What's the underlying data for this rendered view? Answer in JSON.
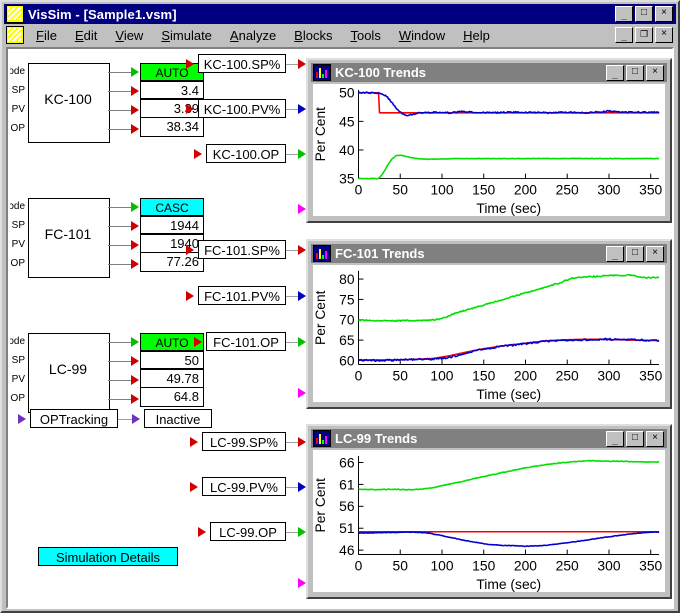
{
  "window": {
    "title": "VisSim - [Sample1.vsm]",
    "app_icon": "vissim-icon",
    "minimize_label": "_",
    "maximize_label": "□",
    "close_label": "×",
    "mdi_restore_label": "❐"
  },
  "menu": {
    "items": [
      {
        "label": "File",
        "accel": "F"
      },
      {
        "label": "Edit",
        "accel": "E"
      },
      {
        "label": "View",
        "accel": "V"
      },
      {
        "label": "Simulate",
        "accel": "S"
      },
      {
        "label": "Analyze",
        "accel": "A"
      },
      {
        "label": "Blocks",
        "accel": "B"
      },
      {
        "label": "Tools",
        "accel": "T"
      },
      {
        "label": "Window",
        "accel": "W"
      },
      {
        "label": "Help",
        "accel": "H"
      }
    ]
  },
  "controllers": [
    {
      "name": "KC-100",
      "pins": [
        "Mode",
        "SP",
        "PV",
        "OP"
      ],
      "mode": "AUTO",
      "mode_color": "#00ff00",
      "sp": "3.4",
      "pv": "3.39",
      "op": "38.34"
    },
    {
      "name": "FC-101",
      "pins": [
        "Mode",
        "SP",
        "PV",
        "OP"
      ],
      "mode": "CASC",
      "mode_color": "#00ffff",
      "sp": "1944",
      "pv": "1940",
      "op": "77.26"
    },
    {
      "name": "LC-99",
      "pins": [
        "Mode",
        "SP",
        "PV",
        "OP"
      ],
      "mode": "AUTO",
      "mode_color": "#00ff00",
      "sp": "50",
      "pv": "49.78",
      "op": "64.8"
    }
  ],
  "signals": [
    {
      "label": "KC-100.SP%",
      "out_color": "red"
    },
    {
      "label": "KC-100.PV%",
      "out_color": "blue"
    },
    {
      "label": "KC-100.OP",
      "out_color": "green"
    },
    {
      "label": "FC-101.SP%",
      "out_color": "red"
    },
    {
      "label": "FC-101.PV%",
      "out_color": "blue"
    },
    {
      "label": "FC-101.OP",
      "out_color": "green"
    },
    {
      "label": "LC-99.SP%",
      "out_color": "red"
    },
    {
      "label": "LC-99.PV%",
      "out_color": "blue"
    },
    {
      "label": "LC-99.OP",
      "out_color": "green"
    }
  ],
  "op_tracking": {
    "label": "OPTracking",
    "status": "Inactive"
  },
  "simulation_details": {
    "label": "Simulation Details",
    "color": "#00ffff"
  },
  "chart_data": [
    {
      "type": "line",
      "title": "KC-100 Trends",
      "xlabel": "Time (sec)",
      "ylabel": "Per Cent",
      "xlim": [
        0,
        360
      ],
      "ylim": [
        35,
        50.5
      ],
      "xticks": [
        0,
        50,
        100,
        150,
        200,
        250,
        300,
        350
      ],
      "yticks": [
        35,
        40,
        45,
        50
      ],
      "grid": false,
      "legend": "none",
      "series": [
        {
          "name": "SP",
          "color": "#ff0000",
          "x": [
            0,
            25,
            25,
            360
          ],
          "values": [
            50,
            50,
            46.5,
            46.5
          ]
        },
        {
          "name": "PV",
          "color": "#0000cd",
          "x": [
            0,
            10,
            20,
            28,
            34,
            40,
            46,
            52,
            58,
            64,
            70,
            80,
            95,
            110,
            125,
            140,
            160,
            180,
            200,
            225,
            250,
            275,
            300,
            320,
            340,
            360
          ],
          "values": [
            50,
            50,
            50,
            49.9,
            49.3,
            48.3,
            47.2,
            46.4,
            46.1,
            46.2,
            46.4,
            46.5,
            46.6,
            46.5,
            46.7,
            46.6,
            46.5,
            46.6,
            46.6,
            46.5,
            46.6,
            46.5,
            46.8,
            46.6,
            46.6,
            46.6
          ],
          "noise": 0.12
        },
        {
          "name": "OP",
          "color": "#00e000",
          "x": [
            0,
            24,
            28,
            32,
            36,
            40,
            45,
            50,
            56,
            62,
            70,
            80,
            95,
            115,
            140,
            170,
            200,
            240,
            280,
            320,
            360
          ],
          "values": [
            35,
            35,
            35.6,
            36.6,
            37.6,
            38.4,
            39.0,
            39.1,
            38.9,
            38.7,
            38.5,
            38.4,
            38.4,
            38.5,
            38.5,
            38.5,
            38.5,
            38.5,
            38.5,
            38.5,
            38.5
          ],
          "noise": 0.04
        }
      ]
    },
    {
      "type": "line",
      "title": "FC-101 Trends",
      "xlabel": "Time (sec)",
      "ylabel": "Per Cent",
      "xlim": [
        0,
        360
      ],
      "ylim": [
        59,
        82
      ],
      "xticks": [
        0,
        50,
        100,
        150,
        200,
        250,
        300,
        350
      ],
      "yticks": [
        60,
        65,
        70,
        75,
        80
      ],
      "grid": false,
      "legend": "none",
      "series": [
        {
          "name": "SP",
          "color": "#ff0000",
          "x": [
            0,
            60,
            90,
            110,
            130,
            150,
            170,
            190,
            210,
            230,
            250,
            270,
            290,
            310,
            330,
            360
          ],
          "values": [
            60.1,
            60.2,
            60.5,
            61.2,
            62.1,
            62.9,
            63.5,
            64.0,
            64.5,
            64.9,
            65.1,
            65.2,
            65.2,
            65.1,
            65.0,
            64.9
          ]
        },
        {
          "name": "PV",
          "color": "#0000cd",
          "x": [
            0,
            20,
            40,
            60,
            80,
            100,
            115,
            130,
            150,
            170,
            190,
            210,
            230,
            250,
            270,
            290,
            310,
            330,
            360
          ],
          "values": [
            60.1,
            60.0,
            60.1,
            60.2,
            60.3,
            60.5,
            61.0,
            61.9,
            62.8,
            63.4,
            63.9,
            64.4,
            64.8,
            65.0,
            65.1,
            65.2,
            65.2,
            65.1,
            64.9
          ],
          "noise": 0.22
        },
        {
          "name": "OP",
          "color": "#00e000",
          "x": [
            0,
            20,
            40,
            60,
            80,
            95,
            105,
            115,
            130,
            145,
            160,
            180,
            200,
            220,
            240,
            255,
            270,
            290,
            310,
            325,
            340,
            360
          ],
          "values": [
            69.9,
            69.8,
            69.7,
            69.8,
            69.8,
            70.1,
            70.6,
            71.6,
            72.4,
            73.3,
            74.2,
            75.4,
            76.6,
            77.8,
            79.0,
            80.2,
            80.5,
            80.7,
            80.9,
            81.0,
            80.4,
            80.3
          ],
          "noise": 0.15
        }
      ]
    },
    {
      "type": "line",
      "title": "LC-99 Trends",
      "xlabel": "Time (sec)",
      "ylabel": "Per Cent",
      "xlim": [
        0,
        360
      ],
      "ylim": [
        45,
        67.5
      ],
      "xticks": [
        0,
        50,
        100,
        150,
        200,
        250,
        300,
        350
      ],
      "yticks": [
        46,
        51,
        56,
        61,
        66
      ],
      "grid": false,
      "legend": "none",
      "series": [
        {
          "name": "SP",
          "color": "#ff0000",
          "x": [
            0,
            360
          ],
          "values": [
            50.2,
            50.2
          ]
        },
        {
          "name": "PV",
          "color": "#0000cd",
          "x": [
            0,
            30,
            60,
            80,
            95,
            110,
            125,
            140,
            155,
            170,
            185,
            200,
            215,
            230,
            250,
            270,
            290,
            310,
            330,
            350,
            360
          ],
          "values": [
            49.9,
            50.0,
            50.1,
            50.0,
            49.5,
            48.9,
            48.3,
            47.8,
            47.3,
            47.1,
            47.0,
            46.9,
            47.0,
            47.2,
            47.7,
            48.2,
            48.8,
            49.3,
            49.8,
            50.1,
            50.1
          ],
          "noise": 0.06
        },
        {
          "name": "OP",
          "color": "#00e000",
          "x": [
            0,
            20,
            40,
            60,
            75,
            90,
            105,
            120,
            140,
            160,
            180,
            200,
            220,
            240,
            260,
            275,
            290,
            310,
            330,
            350,
            360
          ],
          "values": [
            59.9,
            59.8,
            59.9,
            59.8,
            59.9,
            60.3,
            60.9,
            61.5,
            62.4,
            63.2,
            64.0,
            64.8,
            65.4,
            65.9,
            66.2,
            66.4,
            66.3,
            66.3,
            66.2,
            66.1,
            66.1
          ],
          "noise": 0.08
        }
      ]
    }
  ]
}
